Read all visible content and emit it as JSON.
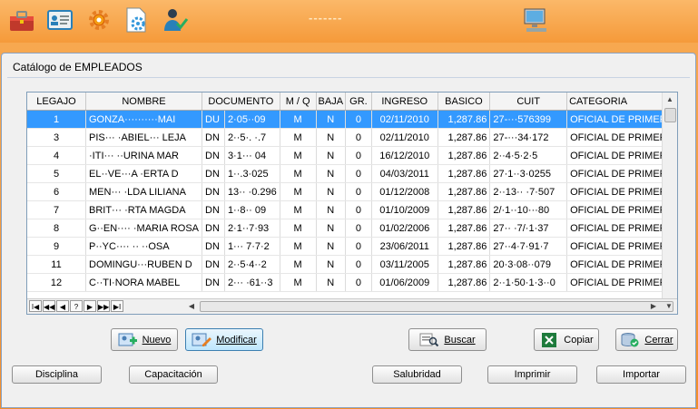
{
  "app": {
    "toolbar_title": "-------",
    "toolbar_icons": [
      "toolbox-icon",
      "id-card-icon",
      "settings-gear-icon",
      "document-gear-icon",
      "user-check-icon",
      "computer-icon"
    ]
  },
  "window": {
    "title": "Catálogo de EMPLEADOS"
  },
  "grid": {
    "columns": [
      "LEGAJO",
      "NOMBRE",
      "DOCUMENTO",
      "M / Q",
      "BAJA",
      "GR.",
      "INGRESO",
      "BASICO",
      "CUIT",
      "CATEGORIA"
    ],
    "rows": [
      [
        "1",
        "GONZA··········MAI",
        "DU",
        "2·05··09",
        "M",
        "N",
        "0",
        "02/11/2010",
        "1,287.86",
        "27-···576399",
        "OFICIAL DE PRIMERA"
      ],
      [
        "3",
        "PIS··· ·ABIEL··· LEJA",
        "DN",
        "2··5·. ·.7",
        "M",
        "N",
        "0",
        "02/11/2010",
        "1,287.86",
        "27-···34·172",
        "OFICIAL DE PRIMERA"
      ],
      [
        "4",
        "·ITI··· ··URINA MAR",
        "DN",
        "3·1··· 04",
        "M",
        "N",
        "0",
        "16/12/2010",
        "1,287.86",
        "2··4·5·2·5",
        "OFICIAL DE PRIMERA"
      ],
      [
        "5",
        "EL··VE···A ·ERTA D",
        "DN",
        "1··.3·025",
        "M",
        "N",
        "0",
        "04/03/2011",
        "1,287.86",
        "27·1··3·0255",
        "OFICIAL DE PRIMERA"
      ],
      [
        "6",
        "MEN··· ·LDA LILIANA",
        "DN",
        "13·· ·0.296",
        "M",
        "N",
        "0",
        "01/12/2008",
        "1,287.86",
        "2··13·· ·7·507",
        "OFICIAL DE PRIMERA"
      ],
      [
        "7",
        "BRIT··· ·RTA MAGDA",
        "DN",
        "1··8·· 09",
        "M",
        "N",
        "0",
        "01/10/2009",
        "1,287.86",
        "2/·1··10···80",
        "OFICIAL DE PRIMERA"
      ],
      [
        "8",
        "G··EN···· ·MARIA ROSA",
        "DN",
        "2·1··7·93",
        "M",
        "N",
        "0",
        "01/02/2006",
        "1,287.86",
        "27·· ·7/·1·37",
        "OFICIAL DE PRIMERA"
      ],
      [
        "9",
        "P··YC···· ·· ··OSA",
        "DN",
        "1··· 7·7·2",
        "M",
        "N",
        "0",
        "23/06/2011",
        "1,287.86",
        "27··4·7·91·7",
        "OFICIAL DE PRIMERA"
      ],
      [
        "11",
        "DOMINGU···RUBEN D",
        "DN",
        "2··5·4··2",
        "M",
        "N",
        "0",
        "03/11/2005",
        "1,287.86",
        "20·3·08··079",
        "OFICIAL DE PRIMERA"
      ],
      [
        "12",
        "C··TI·NORA MABEL",
        "DN",
        "2··· ·61··3",
        "M",
        "N",
        "0",
        "01/06/2009",
        "1,287.86",
        "2··1·50·1·3··0",
        "OFICIAL DE PRIMERA"
      ]
    ],
    "nav_buttons": [
      "I◀",
      "◀◀",
      "◀",
      "?",
      "▶",
      "▶▶",
      "▶I"
    ]
  },
  "buttons": {
    "nuevo": "Nuevo",
    "modificar": "Modificar",
    "buscar": "Buscar",
    "copiar": "Copiar",
    "cerrar": "Cerrar",
    "disciplina": "Disciplina",
    "capacitacion": "Capacitación",
    "salubridad": "Salubridad",
    "imprimir": "Imprimir",
    "importar": "Importar"
  },
  "colors": {
    "selection": "#3399ff",
    "desktop": "#f59a3a"
  }
}
